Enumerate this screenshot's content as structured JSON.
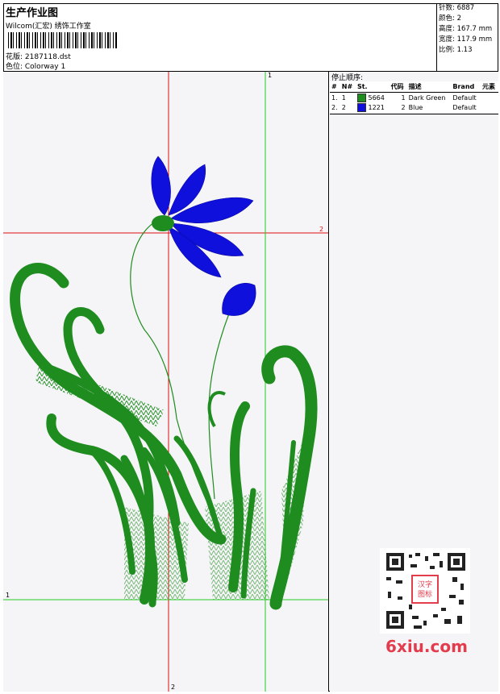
{
  "header": {
    "title": "生产作业图",
    "company": "Wilcom(汇宏) 绣饰工作室",
    "design": "花版: 2187118.dst",
    "colorway": "色位: Colorway 1"
  },
  "stats": {
    "stitches": "针数: 6887",
    "colors": "颜色: 2",
    "height": "高度: 167.7 mm",
    "width": "宽度: 117.9 mm",
    "scale": "比例: 1.13"
  },
  "stop_sequence": {
    "title": "停止顺序:",
    "columns": [
      "#",
      "N#",
      "St.",
      "代码",
      "描述",
      "Brand",
      "元素"
    ],
    "rows": [
      {
        "idx": "1.",
        "n": "1",
        "st": "5664",
        "code": "1",
        "desc": "Dark Green",
        "brand": "Default",
        "color": "#1f8c1f"
      },
      {
        "idx": "2.",
        "n": "2",
        "st": "1221",
        "code": "2",
        "desc": "Blue",
        "brand": "Default",
        "color": "#1010dd"
      }
    ]
  },
  "guides": {
    "red_v_top": "",
    "green_v_top": "1",
    "red_h_right": "2",
    "green_h_left": "1",
    "red_v_bottom": "2"
  },
  "watermark": "6xiu.com",
  "qr_badge": "汉字\n图标",
  "colors": {
    "green": "#1f8c1f",
    "blue": "#1010dd",
    "red_guide": "#e01010",
    "green_guide": "#22cc22"
  }
}
